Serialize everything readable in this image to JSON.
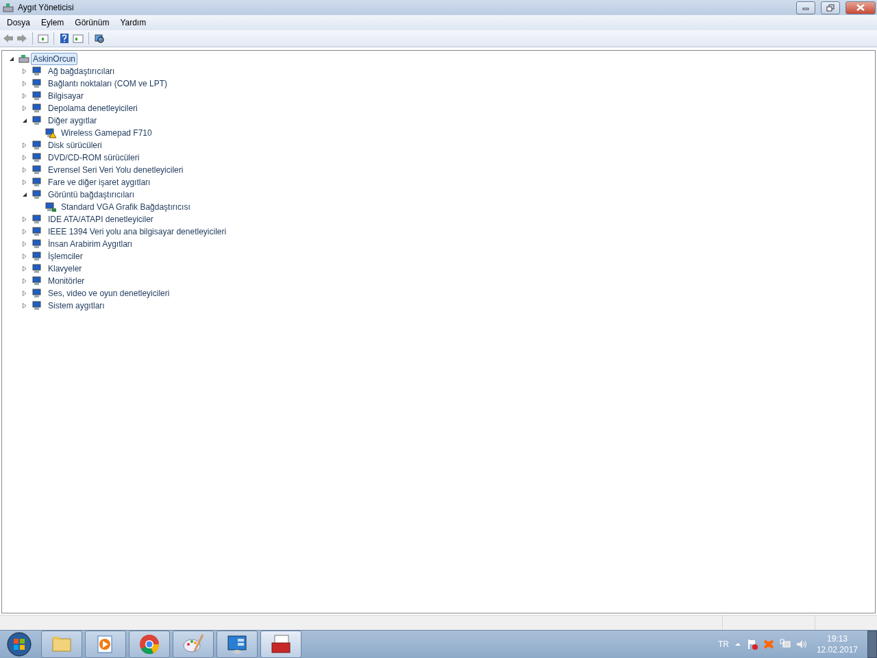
{
  "window": {
    "title": "Aygıt Yöneticisi"
  },
  "menu": [
    "Dosya",
    "Eylem",
    "Görünüm",
    "Yardım"
  ],
  "tree": {
    "label": "AskinOrcun",
    "selected": true,
    "expanded": true,
    "children": [
      {
        "label": "Ağ bağdaştırıcıları",
        "expanded": false
      },
      {
        "label": "Bağlantı noktaları (COM ve LPT)",
        "expanded": false
      },
      {
        "label": "Bilgisayar",
        "expanded": false
      },
      {
        "label": "Depolama denetleyicileri",
        "expanded": false
      },
      {
        "label": "Diğer aygıtlar",
        "expanded": true,
        "children": [
          {
            "label": "Wireless Gamepad F710",
            "warning": true
          }
        ]
      },
      {
        "label": "Disk sürücüleri",
        "expanded": false
      },
      {
        "label": "DVD/CD-ROM sürücüleri",
        "expanded": false
      },
      {
        "label": "Evrensel Seri Veri Yolu denetleyicileri",
        "expanded": false
      },
      {
        "label": "Fare ve diğer işaret aygıtları",
        "expanded": false
      },
      {
        "label": "Görüntü bağdaştırıcıları",
        "expanded": true,
        "children": [
          {
            "label": "Standard VGA Grafik Bağdaştırıcısı",
            "warning": false
          }
        ]
      },
      {
        "label": "IDE ATA/ATAPI denetleyiciler",
        "expanded": false
      },
      {
        "label": "IEEE 1394 Veri yolu ana bilgisayar denetleyicileri",
        "expanded": false
      },
      {
        "label": "İnsan Arabirim Aygıtları",
        "expanded": false
      },
      {
        "label": "İşlemciler",
        "expanded": false
      },
      {
        "label": "Klavyeler",
        "expanded": false
      },
      {
        "label": "Monitörler",
        "expanded": false
      },
      {
        "label": "Ses, video ve oyun denetleyicileri",
        "expanded": false
      },
      {
        "label": "Sistem aygıtları",
        "expanded": false
      }
    ]
  },
  "taskbar": {
    "apps": [
      {
        "kind": "folder",
        "selected": false
      },
      {
        "kind": "media",
        "selected": false
      },
      {
        "kind": "browser",
        "selected": false
      },
      {
        "kind": "paint",
        "selected": false
      },
      {
        "kind": "panel",
        "selected": false
      },
      {
        "kind": "toolbox",
        "selected": true
      }
    ],
    "language": "TR",
    "time": "19:13",
    "date": "12.02.2017"
  }
}
